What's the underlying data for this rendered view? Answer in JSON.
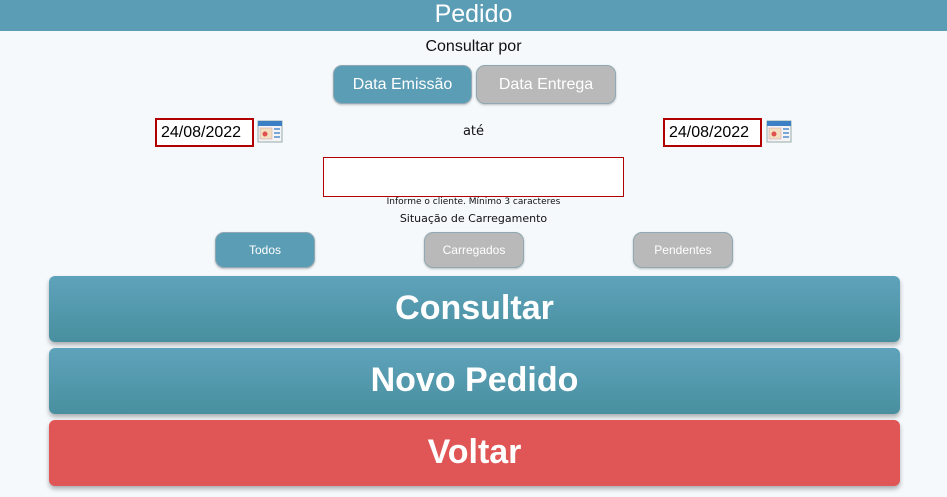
{
  "header": {
    "title": "Pedido"
  },
  "consultar_por": {
    "label": "Consultar por",
    "options": [
      {
        "label": "Data Emissão",
        "active": true
      },
      {
        "label": "Data Entrega",
        "active": false
      }
    ]
  },
  "dates": {
    "start": "24/08/2022",
    "separator": "até",
    "end": "24/08/2022"
  },
  "client": {
    "value": "",
    "hint": "Informe o cliente. Mínimo 3 caracteres"
  },
  "situacao": {
    "label": "Situação de Carregamento",
    "options": [
      {
        "label": "Todos",
        "active": true
      },
      {
        "label": "Carregados",
        "active": false
      },
      {
        "label": "Pendentes",
        "active": false
      }
    ]
  },
  "actions": {
    "consultar": "Consultar",
    "novo_pedido": "Novo Pedido",
    "voltar": "Voltar"
  },
  "colors": {
    "primary": "#5b9db5",
    "inactive": "#b9b9b9",
    "danger": "#e05555",
    "error_border": "#b00000"
  },
  "icons": {
    "calendar": "calendar-icon"
  }
}
